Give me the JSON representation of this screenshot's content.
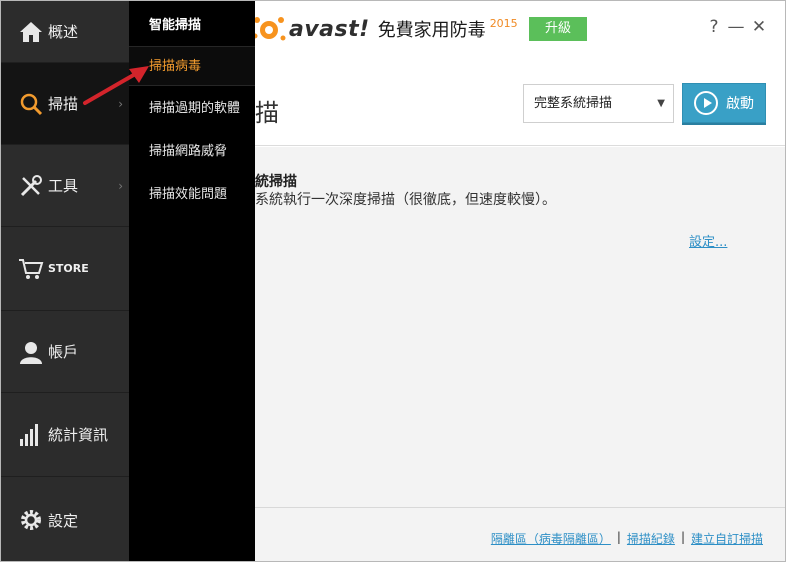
{
  "app": {
    "brand": "avast!",
    "product": "免費家用防毒",
    "year": "2015",
    "upgrade": "升級",
    "help": "?",
    "minimize": "—",
    "close": "✕"
  },
  "sidebar": {
    "items": [
      {
        "label": "概述",
        "icon": "home-icon"
      },
      {
        "label": "掃描",
        "icon": "search-icon",
        "active": true
      },
      {
        "label": "工具",
        "icon": "tools-icon"
      },
      {
        "label": "STORE",
        "icon": "cart-icon"
      },
      {
        "label": "帳戶",
        "icon": "user-icon"
      },
      {
        "label": "統計資訊",
        "icon": "stats-icon"
      },
      {
        "label": "設定",
        "icon": "gear-icon"
      }
    ]
  },
  "submenu": {
    "title": "智能掃描",
    "items": [
      {
        "label": "掃描病毒",
        "highlighted": true
      },
      {
        "label": "掃描過期的軟體"
      },
      {
        "label": "掃描網路威脅"
      },
      {
        "label": "掃描效能問題"
      }
    ]
  },
  "main": {
    "heading_tail": "描",
    "scan_select": "完整系統掃描",
    "start_button": "啟動",
    "scan_title": "統掃描",
    "scan_desc": "系統執行一次深度掃描（很徹底，但速度較慢）。",
    "settings_link": "設定..."
  },
  "footer": {
    "links": [
      "隔離區（病毒隔離區）",
      "掃描紀錄",
      "建立自訂掃描"
    ],
    "separator": "|"
  },
  "colors": {
    "accent": "#39a0c6",
    "upgrade": "#5bbf5a",
    "highlight": "#f29b2e",
    "arrow": "#d3242b"
  }
}
